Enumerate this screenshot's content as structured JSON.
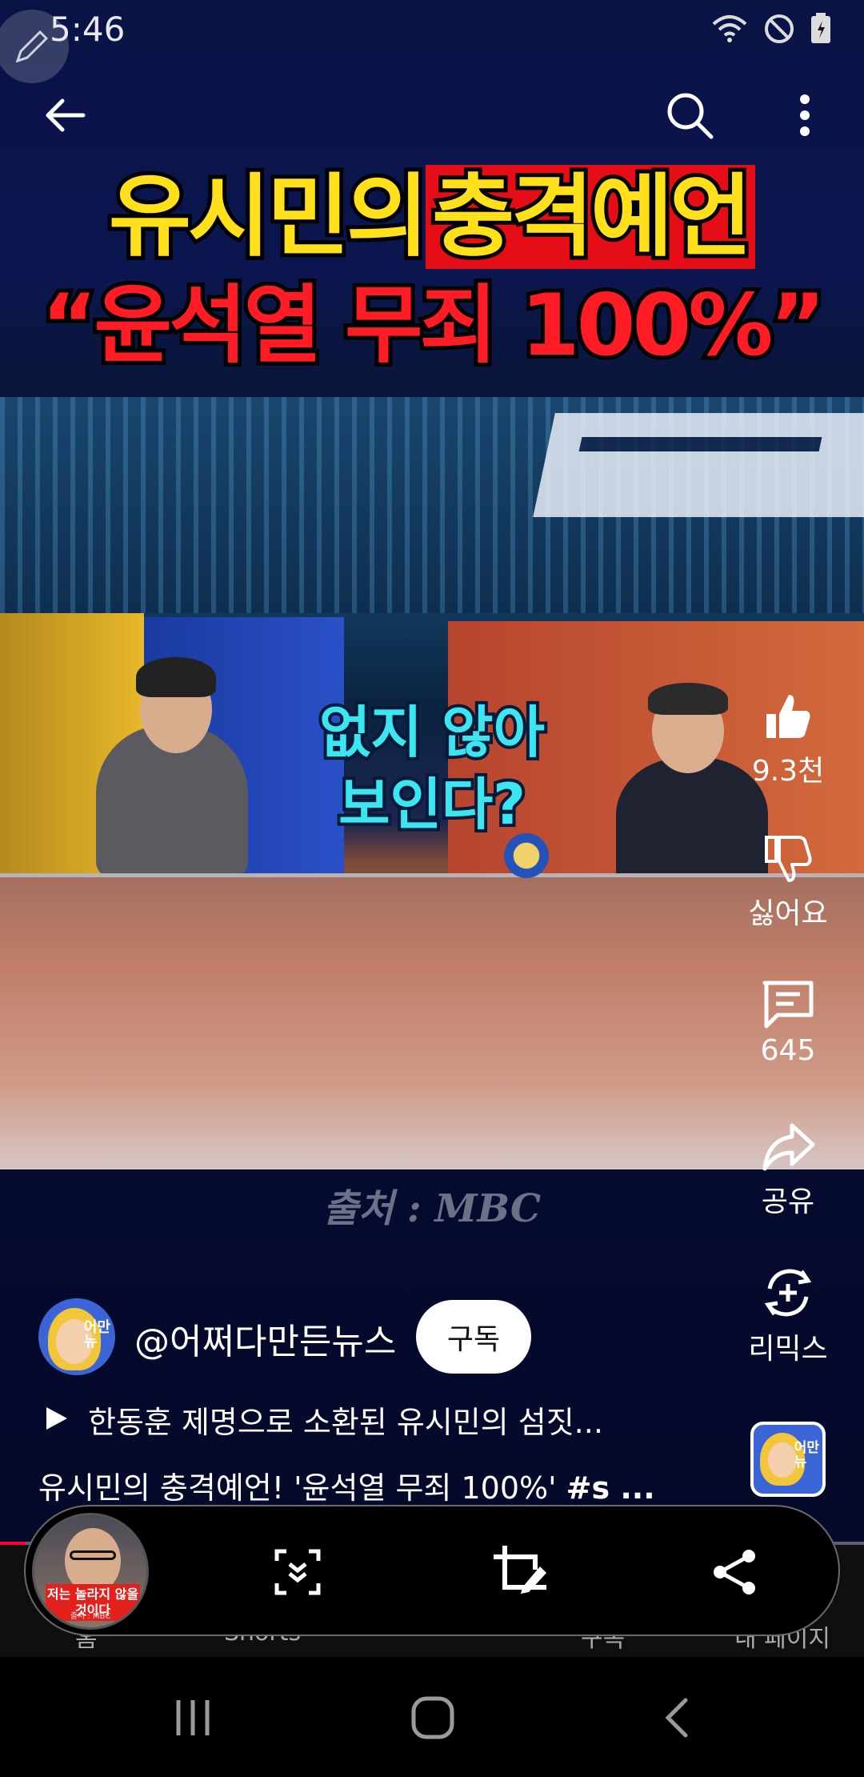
{
  "status_bar": {
    "time": "5:46"
  },
  "video": {
    "title_line1_part1": "유시민의",
    "title_line1_part2": "충격예언",
    "title_line2": "“윤석열 무죄 100%”",
    "subtitle_line1": "없지 않아",
    "subtitle_line2": "보인다?",
    "source_caption": "출처 : MBC",
    "progress_fraction": 0.03
  },
  "actions": {
    "like_count": "9.3천",
    "dislike_label": "싫어요",
    "comment_count": "645",
    "share_label": "공유",
    "remix_label": "리믹스"
  },
  "channel": {
    "handle": "@어쩌다만든뉴스",
    "avatar_text": "어만\n뉴",
    "subscribe_label": "구독"
  },
  "playlist": {
    "text": "한동훈 제명으로 소환된 유시민의 섬짓..."
  },
  "description": {
    "text": "유시민의 충격예언! '윤석열 무죄 100%' ",
    "tag": "#s ..."
  },
  "bottom_nav": {
    "home": "홈",
    "shorts": "Shorts",
    "subscriptions": "구독",
    "library": "내 페이지"
  },
  "capture_toolbar": {
    "thumb_caption": "저는 놀라지 않을 것이다",
    "thumb_source": "출처 : MBC"
  },
  "colors": {
    "accent": "#ff0033",
    "title_yellow": "#ffe01b",
    "title_red": "#ff1c24",
    "subtitle_cyan": "#3ce6f0"
  },
  "icons": [
    "pen-icon",
    "wifi-icon",
    "do-not-disturb-icon",
    "battery-icon",
    "back-arrow-icon",
    "search-icon",
    "more-vert-icon",
    "thumb-up-icon",
    "thumb-down-icon",
    "comment-icon",
    "share-icon",
    "remix-icon",
    "play-icon",
    "scroll-capture-icon",
    "crop-edit-icon",
    "share-capture-icon",
    "recents-icon",
    "home-icon",
    "system-back-icon"
  ]
}
